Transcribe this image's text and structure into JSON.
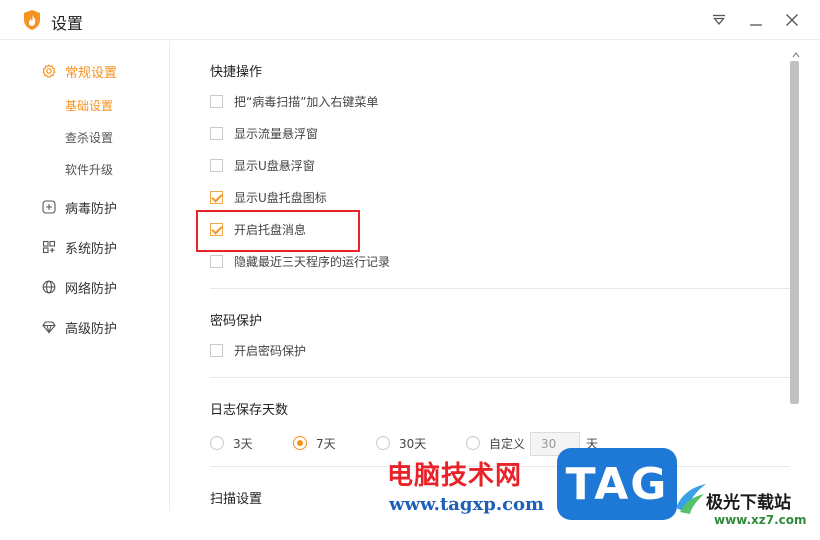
{
  "window": {
    "title": "设置",
    "controls": [
      "dropdown-icon",
      "minimize-icon",
      "close-icon"
    ]
  },
  "sidebar": {
    "items": [
      {
        "label": "常规设置",
        "icon": "gear-icon",
        "active": true,
        "children": [
          {
            "label": "基础设置",
            "active": true
          },
          {
            "label": "查杀设置",
            "active": false
          },
          {
            "label": "软件升级",
            "active": false
          }
        ]
      },
      {
        "label": "病毒防护",
        "icon": "plus-square-icon",
        "active": false
      },
      {
        "label": "系统防护",
        "icon": "grid-icon",
        "active": false
      },
      {
        "label": "网络防护",
        "icon": "globe-icon",
        "active": false
      },
      {
        "label": "高级防护",
        "icon": "diamond-icon",
        "active": false
      }
    ]
  },
  "content": {
    "quick_ops": {
      "title": "快捷操作",
      "options": [
        {
          "label": "把“病毒扫描”加入右键菜单",
          "checked": false
        },
        {
          "label": "显示流量悬浮窗",
          "checked": false
        },
        {
          "label": "显示U盘悬浮窗",
          "checked": false
        },
        {
          "label": "显示U盘托盘图标",
          "checked": true
        },
        {
          "label": "开启托盘消息",
          "checked": true
        },
        {
          "label": "隐藏最近三天程序的运行记录",
          "checked": false
        }
      ]
    },
    "password": {
      "title": "密码保护",
      "options": [
        {
          "label": "开启密码保护",
          "checked": false
        }
      ]
    },
    "log_days": {
      "title": "日志保存天数",
      "options": [
        {
          "label": "3天",
          "checked": false
        },
        {
          "label": "7天",
          "checked": true
        },
        {
          "label": "30天",
          "checked": false
        },
        {
          "label": "自定义",
          "checked": false
        }
      ],
      "custom_value": "30",
      "custom_unit": "天"
    },
    "scan": {
      "title": "扫描设置"
    }
  },
  "watermark": {
    "text": "电脑技术网",
    "url": "www.tagxp.com",
    "tag": "TAG",
    "site": "极光下载站",
    "site_url": "www.xz7.com"
  },
  "colors": {
    "accent": "#f59321",
    "highlight": "#e8232a",
    "watermark_blue": "#1e78d6"
  }
}
